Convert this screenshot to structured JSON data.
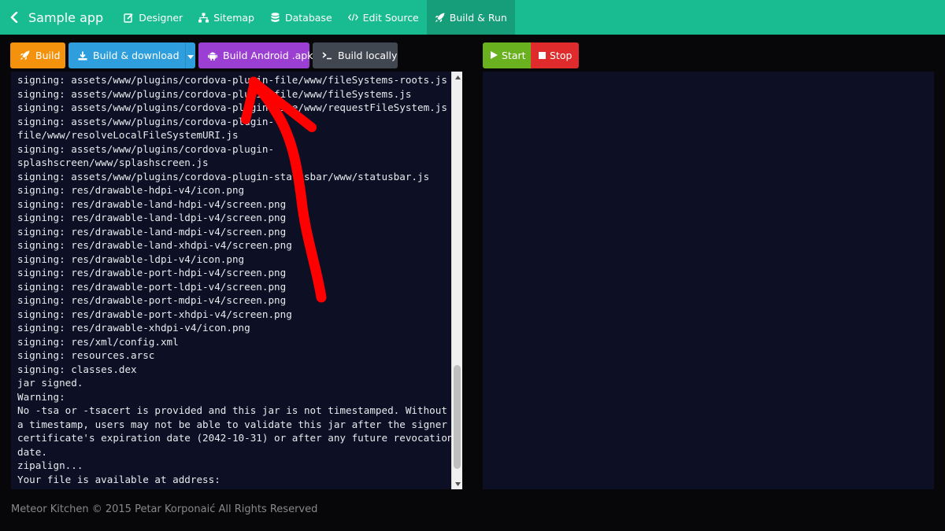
{
  "app": {
    "title": "Sample app"
  },
  "nav": {
    "items": [
      {
        "label": "Designer",
        "icon": "edit-icon"
      },
      {
        "label": "Sitemap",
        "icon": "sitemap-icon"
      },
      {
        "label": "Database",
        "icon": "database-icon"
      },
      {
        "label": "Edit Source",
        "icon": "code-icon"
      },
      {
        "label": "Build & Run",
        "icon": "rocket-icon",
        "active": true
      }
    ]
  },
  "toolbar": {
    "build_label": "Build",
    "download_label": "Build & download",
    "android_label": "Build Android .apk",
    "local_label": "Build locally",
    "start_label": "Start",
    "stop_label": "Stop"
  },
  "colors": {
    "nav": "#19bc90",
    "build": "#f5920d",
    "download": "#2e9fdc",
    "android": "#9b3fd2",
    "local": "#414750",
    "start": "#6ab11f",
    "stop": "#df2b2b",
    "console_bg": "#0d1024",
    "annotation": "#ff0000"
  },
  "console": {
    "lines": [
      "signing: assets/www/plugins/cordova-plugin-file/www/fileSystems-roots.js",
      "signing: assets/www/plugins/cordova-plugin-file/www/fileSystems.js",
      "signing: assets/www/plugins/cordova-plugin-file/www/requestFileSystem.js",
      "signing: assets/www/plugins/cordova-plugin-",
      "file/www/resolveLocalFileSystemURI.js",
      "signing: assets/www/plugins/cordova-plugin-",
      "splashscreen/www/splashscreen.js",
      "signing: assets/www/plugins/cordova-plugin-statusbar/www/statusbar.js",
      "signing: res/drawable-hdpi-v4/icon.png",
      "signing: res/drawable-land-hdpi-v4/screen.png",
      "signing: res/drawable-land-ldpi-v4/screen.png",
      "signing: res/drawable-land-mdpi-v4/screen.png",
      "signing: res/drawable-land-xhdpi-v4/screen.png",
      "signing: res/drawable-ldpi-v4/icon.png",
      "signing: res/drawable-port-hdpi-v4/screen.png",
      "signing: res/drawable-port-ldpi-v4/screen.png",
      "signing: res/drawable-port-mdpi-v4/screen.png",
      "signing: res/drawable-port-xhdpi-v4/screen.png",
      "signing: res/drawable-xhdpi-v4/icon.png",
      "signing: res/xml/config.xml",
      "signing: resources.arsc",
      "signing: classes.dex",
      "jar signed.",
      "Warning:",
      "No -tsa or -tsacert is provided and this jar is not timestamped. Without",
      "a timestamp, users may not be able to validate this jar after the signer",
      "certificate's expiration date (2042-10-31) or after any future revocation",
      "date.",
      "zipalign...",
      "Your file is available at address:"
    ]
  },
  "footer": {
    "text": "Meteor Kitchen © 2015 Petar Korponaić All Rights Reserved"
  }
}
